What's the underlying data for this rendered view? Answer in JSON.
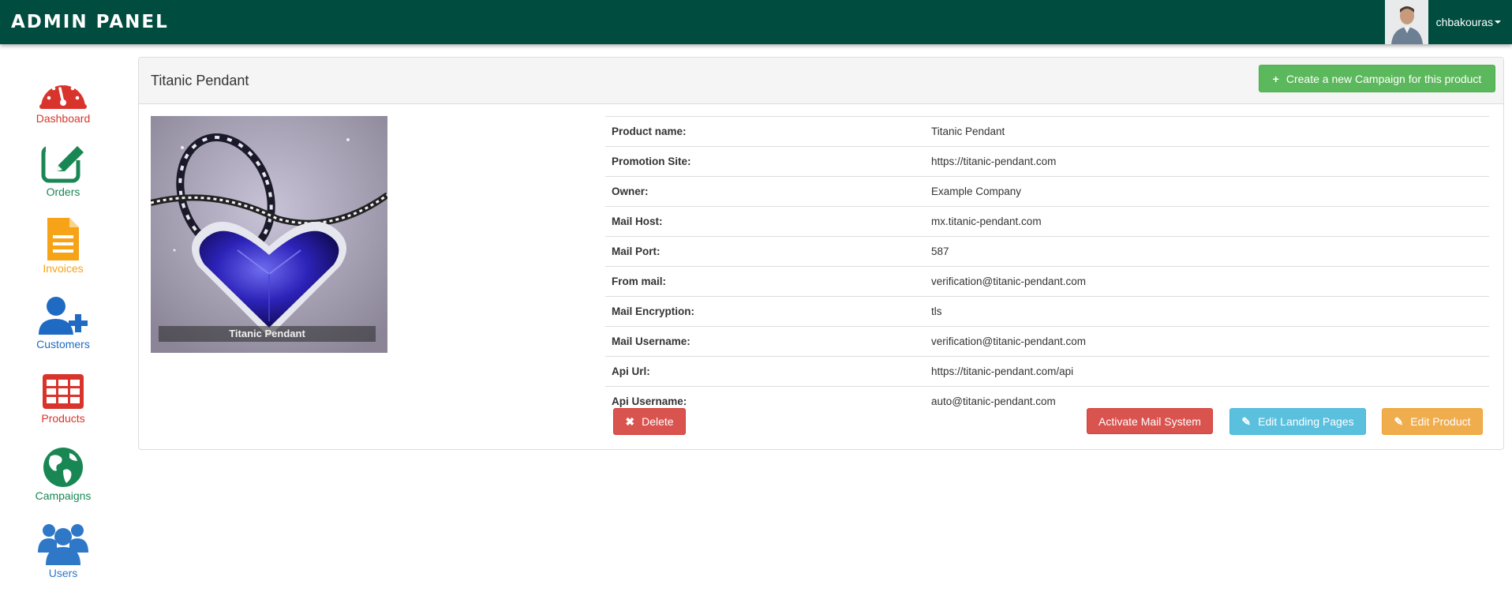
{
  "header": {
    "brand": "ADMIN PANEL",
    "username": "chbakouras"
  },
  "sidebar": {
    "items": [
      {
        "label": "Dashboard",
        "icon": "speedometer-icon",
        "color": "#d9342b"
      },
      {
        "label": "Orders",
        "icon": "edit-icon",
        "color": "#198754"
      },
      {
        "label": "Invoices",
        "icon": "file-icon",
        "color": "#f6a317"
      },
      {
        "label": "Customers",
        "icon": "user-plus-icon",
        "color": "#1f6bc4"
      },
      {
        "label": "Products",
        "icon": "table-icon",
        "color": "#d9342b"
      },
      {
        "label": "Campaigns",
        "icon": "globe-icon",
        "color": "#198754"
      },
      {
        "label": "Users",
        "icon": "users-icon",
        "color": "#2f77c7"
      }
    ]
  },
  "panel": {
    "title": "Titanic Pendant",
    "create_campaign_label": "Create a new Campaign for this product",
    "image_caption": "Titanic Pendant"
  },
  "details": [
    {
      "label": "Product name:",
      "value": "Titanic Pendant"
    },
    {
      "label": "Promotion Site:",
      "value": "https://titanic-pendant.com"
    },
    {
      "label": "Owner:",
      "value": "Example Company"
    },
    {
      "label": "Mail Host:",
      "value": "mx.titanic-pendant.com"
    },
    {
      "label": "Mail Port:",
      "value": "587"
    },
    {
      "label": "From mail:",
      "value": "verification@titanic-pendant.com"
    },
    {
      "label": "Mail Encryption:",
      "value": "tls"
    },
    {
      "label": "Mail Username:",
      "value": "verification@titanic-pendant.com"
    },
    {
      "label": "Api Url:",
      "value": "https://titanic-pendant.com/api"
    },
    {
      "label": "Api Username:",
      "value": "auto@titanic-pendant.com"
    }
  ],
  "actions": {
    "delete_label": "Delete",
    "activate_mail_label": "Activate Mail System",
    "edit_landing_label": "Edit Landing Pages",
    "edit_product_label": "Edit Product"
  },
  "colors": {
    "topbar": "#004c3f",
    "success": "#5cb85c",
    "danger": "#d9534f",
    "info": "#5bc0de",
    "warning": "#f0ad4e"
  }
}
